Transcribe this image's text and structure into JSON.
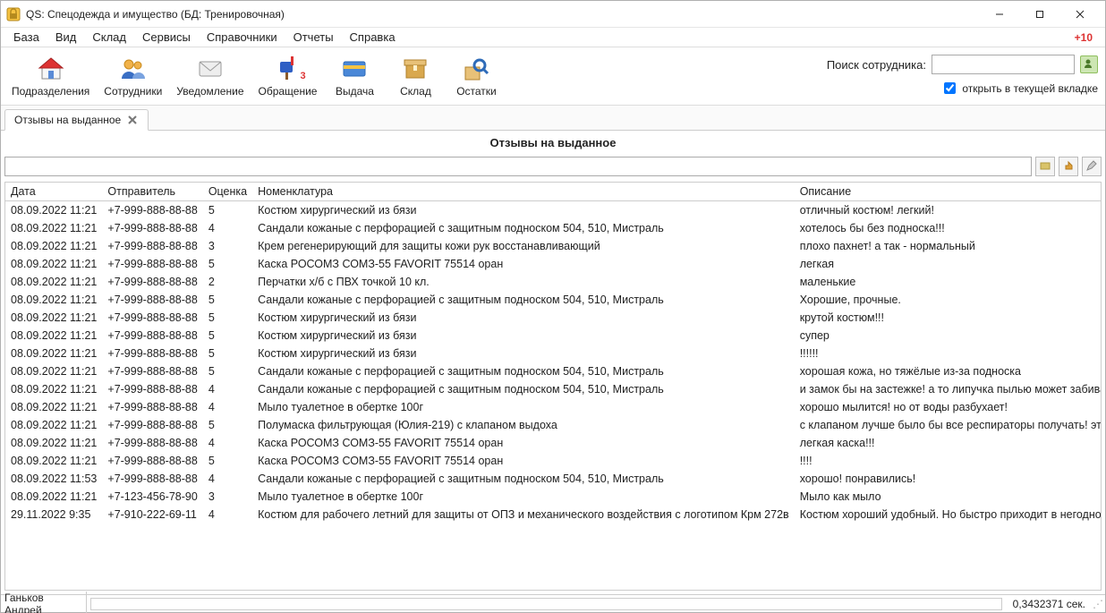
{
  "window": {
    "title": "QS: Спецодежда и имущество (БД: Тренировочная)"
  },
  "menu": {
    "items": [
      "База",
      "Вид",
      "Склад",
      "Сервисы",
      "Справочники",
      "Отчеты",
      "Справка"
    ],
    "right_badge": "+10"
  },
  "toolbar": {
    "items": [
      {
        "label": "Подразделения",
        "icon": "home",
        "badge": ""
      },
      {
        "label": "Сотрудники",
        "icon": "users",
        "badge": ""
      },
      {
        "label": "Уведомление",
        "icon": "mail",
        "badge": ""
      },
      {
        "label": "Обращение",
        "icon": "mailbox",
        "badge": "3"
      },
      {
        "label": "Выдача",
        "icon": "card",
        "badge": ""
      },
      {
        "label": "Склад",
        "icon": "box",
        "badge": ""
      },
      {
        "label": "Остатки",
        "icon": "search-box",
        "badge": ""
      }
    ],
    "search_label": "Поиск сотрудника:",
    "search_value": "",
    "open_in_current_tab": "открыть в текущей вкладке",
    "open_in_current_tab_checked": true
  },
  "tab": {
    "label": "Отзывы на выданное"
  },
  "section_title": "Отзывы на выданное",
  "list_search_value": "",
  "columns": {
    "date": "Дата",
    "sender": "Отправитель",
    "rating": "Оценка",
    "item": "Номенклатура",
    "desc": "Описание"
  },
  "rows": [
    {
      "date": "08.09.2022 11:21",
      "sender": "+7-999-888-88-88",
      "rating": "5",
      "item": "Костюм хирургический из бязи",
      "desc": "отличный костюм! легкий!"
    },
    {
      "date": "08.09.2022 11:21",
      "sender": "+7-999-888-88-88",
      "rating": "4",
      "item": "Сандали кожаные с перфорацией с защитным подноском 504, 510, Мистраль",
      "desc": "хотелось бы без подноска!!!"
    },
    {
      "date": "08.09.2022 11:21",
      "sender": "+7-999-888-88-88",
      "rating": "3",
      "item": "Крем регенерирующий для защиты кожи рук восстанавливающий",
      "desc": "плохо пахнет! а так - нормальный"
    },
    {
      "date": "08.09.2022 11:21",
      "sender": "+7-999-888-88-88",
      "rating": "5",
      "item": "Каска РОСОМЗ СОМЗ-55 FAVORIT 75514 оран",
      "desc": "легкая"
    },
    {
      "date": "08.09.2022 11:21",
      "sender": "+7-999-888-88-88",
      "rating": "2",
      "item": "Перчатки х/б с ПВХ точкой 10 кл.",
      "desc": "маленькие"
    },
    {
      "date": "08.09.2022 11:21",
      "sender": "+7-999-888-88-88",
      "rating": "5",
      "item": "Сандали кожаные с перфорацией с защитным подноском 504, 510, Мистраль",
      "desc": "Хорошие, прочные."
    },
    {
      "date": "08.09.2022 11:21",
      "sender": "+7-999-888-88-88",
      "rating": "5",
      "item": "Костюм хирургический из бязи",
      "desc": "крутой костюм!!!"
    },
    {
      "date": "08.09.2022 11:21",
      "sender": "+7-999-888-88-88",
      "rating": "5",
      "item": "Костюм хирургический из бязи",
      "desc": "супер"
    },
    {
      "date": "08.09.2022 11:21",
      "sender": "+7-999-888-88-88",
      "rating": "5",
      "item": "Костюм хирургический из бязи",
      "desc": "!!!!!!"
    },
    {
      "date": "08.09.2022 11:21",
      "sender": "+7-999-888-88-88",
      "rating": "5",
      "item": "Сандали кожаные с перфорацией с защитным подноском 504, 510, Мистраль",
      "desc": "хорошая кожа, но тяжёлые из-за подноска"
    },
    {
      "date": "08.09.2022 11:21",
      "sender": "+7-999-888-88-88",
      "rating": "4",
      "item": "Сандали кожаные с перфорацией с защитным подноском 504, 510, Мистраль",
      "desc": "и замок бы на застежке! а то липучка пылью может забиваться!"
    },
    {
      "date": "08.09.2022 11:21",
      "sender": "+7-999-888-88-88",
      "rating": "4",
      "item": "Мыло туалетное в обертке 100г",
      "desc": "хорошо мылится! но от воды разбухает!"
    },
    {
      "date": "08.09.2022 11:21",
      "sender": "+7-999-888-88-88",
      "rating": "5",
      "item": "Полумаска фильтрующая (Юлия-219) с клапаном выдоха",
      "desc": "с клапаном лучше было бы все респираторы получать! этот хороший!"
    },
    {
      "date": "08.09.2022 11:21",
      "sender": "+7-999-888-88-88",
      "rating": "4",
      "item": "Каска РОСОМЗ СОМЗ-55 FAVORIT 75514 оран",
      "desc": "легкая каска!!!"
    },
    {
      "date": "08.09.2022 11:21",
      "sender": "+7-999-888-88-88",
      "rating": "5",
      "item": "Каска РОСОМЗ СОМЗ-55 FAVORIT 75514 оран",
      "desc": "!!!!"
    },
    {
      "date": "08.09.2022 11:53",
      "sender": "+7-999-888-88-88",
      "rating": "4",
      "item": "Сандали кожаные с перфорацией с защитным подноском 504, 510, Мистраль",
      "desc": "хорошо! понравились!"
    },
    {
      "date": "08.09.2022 11:21",
      "sender": "+7-123-456-78-90",
      "rating": "3",
      "item": "Мыло туалетное в обертке 100г",
      "desc": "Мыло как мыло"
    },
    {
      "date": "29.11.2022 9:35",
      "sender": "+7-910-222-69-11",
      "rating": "4",
      "item": "Костюм для рабочего летний для защиты от ОПЗ и механического воздействия с логотипом Крм 272в",
      "desc": "Костюм хороший удобный. Но быстро приходит в негодность."
    }
  ],
  "status": {
    "user": "Ганьков Андрей",
    "timing": "0,3432371 сек."
  }
}
